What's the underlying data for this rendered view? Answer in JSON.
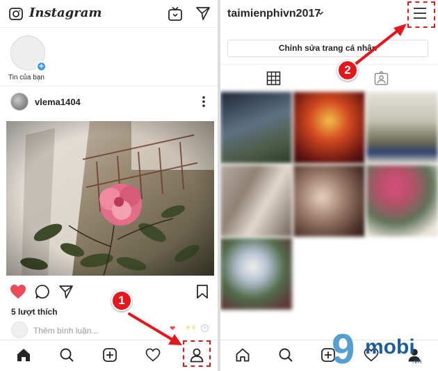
{
  "left_screen": {
    "app_name": "Instagram",
    "story_label": "Tin của bạn",
    "post": {
      "username": "vlema1404",
      "likes_text": "5 lượt thích",
      "comment_placeholder": "Thêm bình luận..."
    },
    "tabbar": [
      "home-icon",
      "search-icon",
      "add-icon",
      "heart-icon",
      "profile-icon"
    ]
  },
  "right_screen": {
    "username": "taimienphivn2017",
    "edit_profile_label": "Chỉnh sửa trang cá nhân",
    "tabs": [
      "grid-icon",
      "tagged-icon"
    ],
    "grid_cell_colors": [
      "#53606f",
      "#b2271c",
      "#a9a78f",
      "#8f8274",
      "#6b5044",
      "#d7c9ba",
      "#5f7258"
    ],
    "tabbar": [
      "home-icon",
      "search-icon",
      "add-icon",
      "heart-icon",
      "profile-icon"
    ]
  },
  "annotations": {
    "step_1": "1",
    "step_2": "2",
    "highlight_color": "#e5161c"
  },
  "watermark": {
    "number": "9",
    "brand": "mobi",
    "tld": ".vn"
  },
  "colors": {
    "like_red": "#ed4956",
    "story_blue": "#3897f0"
  }
}
